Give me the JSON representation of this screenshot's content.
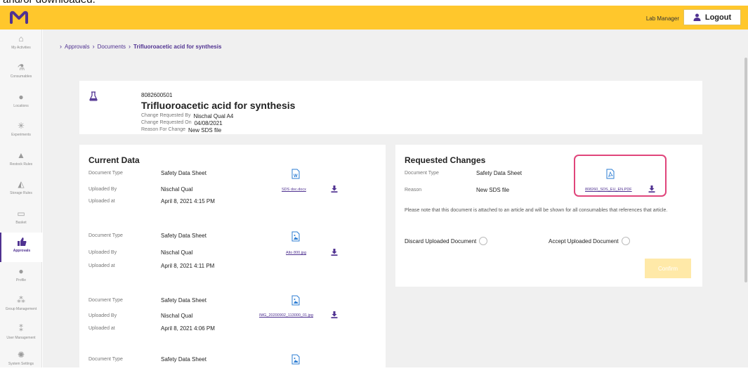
{
  "caption": "and/or downloaded.",
  "topbar": {
    "role": "Lab Manager",
    "logout_label": "Logout",
    "brand_color": "#ffc72c",
    "accent_color": "#503291"
  },
  "sidebar": {
    "items": [
      {
        "label": "My Activities",
        "icon": "home-icon"
      },
      {
        "label": "Consumables",
        "icon": "flask-icon"
      },
      {
        "label": "Locations",
        "icon": "location-pin-icon"
      },
      {
        "label": "Experiments",
        "icon": "molecule-icon"
      },
      {
        "label": "Restock Rules",
        "icon": "bell-icon"
      },
      {
        "label": "Storage Rules",
        "icon": "storage-icon"
      },
      {
        "label": "Basket",
        "icon": "basket-icon"
      },
      {
        "label": "Approvals",
        "icon": "thumbs-up-icon",
        "active": true
      },
      {
        "label": "Profile",
        "icon": "user-icon"
      },
      {
        "label": "Group Management",
        "icon": "group-icon"
      },
      {
        "label": "User Management",
        "icon": "users-icon"
      },
      {
        "label": "System Settings",
        "icon": "gear-icon"
      }
    ]
  },
  "breadcrumb": {
    "items": [
      "Approvals",
      "Documents"
    ],
    "current": "Trifluoroacetic acid for synthesis"
  },
  "header": {
    "article_id": "8082600501",
    "title": "Trifluoroacetic acid for synthesis",
    "requested_by_label": "Change Requested By",
    "requested_by": "Nischal Qual A4",
    "requested_on_label": "Change Requested On",
    "requested_on": "04/08/2021",
    "reason_label": "Reason For Change",
    "reason": "New SDS file"
  },
  "current_data": {
    "title": "Current Data",
    "labels": {
      "doc_type": "Document Type",
      "uploaded_by": "Uploaded By",
      "uploaded_at": "Uploaded at"
    },
    "documents": [
      {
        "doc_type": "Safety Data Sheet",
        "uploaded_by": "Nischal Qual",
        "uploaded_at": "April 8, 2021 4:15 PM",
        "file": "SDS doc.docx",
        "icon": "word-file-icon"
      },
      {
        "doc_type": "Safety Data Sheet",
        "uploaded_by": "Nischal Qual",
        "uploaded_at": "April 8, 2021 4:11 PM",
        "file": "Alto 800.jpg",
        "icon": "image-file-icon"
      },
      {
        "doc_type": "Safety Data Sheet",
        "uploaded_by": "Nischal Qual",
        "uploaded_at": "April 8, 2021 4:06 PM",
        "file": "IMG_20200902_113000_01.jpg",
        "icon": "image-file-icon"
      },
      {
        "doc_type": "Safety Data Sheet",
        "uploaded_by": "",
        "uploaded_at": "",
        "file": "",
        "icon": "image-file-icon"
      }
    ]
  },
  "requested_changes": {
    "title": "Requested Changes",
    "doc_type_label": "Document Type",
    "doc_type": "Safety Data Sheet",
    "reason_label": "Reason",
    "reason": "New SDS file",
    "file": "808260_SDS_EU_EN.PDF",
    "note": "Please note that this document is attached to an article and will be shown for all consumables that references that article.",
    "discard_label": "Discard Uploaded Document",
    "accept_label": "Accept Uploaded Document",
    "confirm_label": "Confirm",
    "highlight_color": "#e0457b"
  }
}
